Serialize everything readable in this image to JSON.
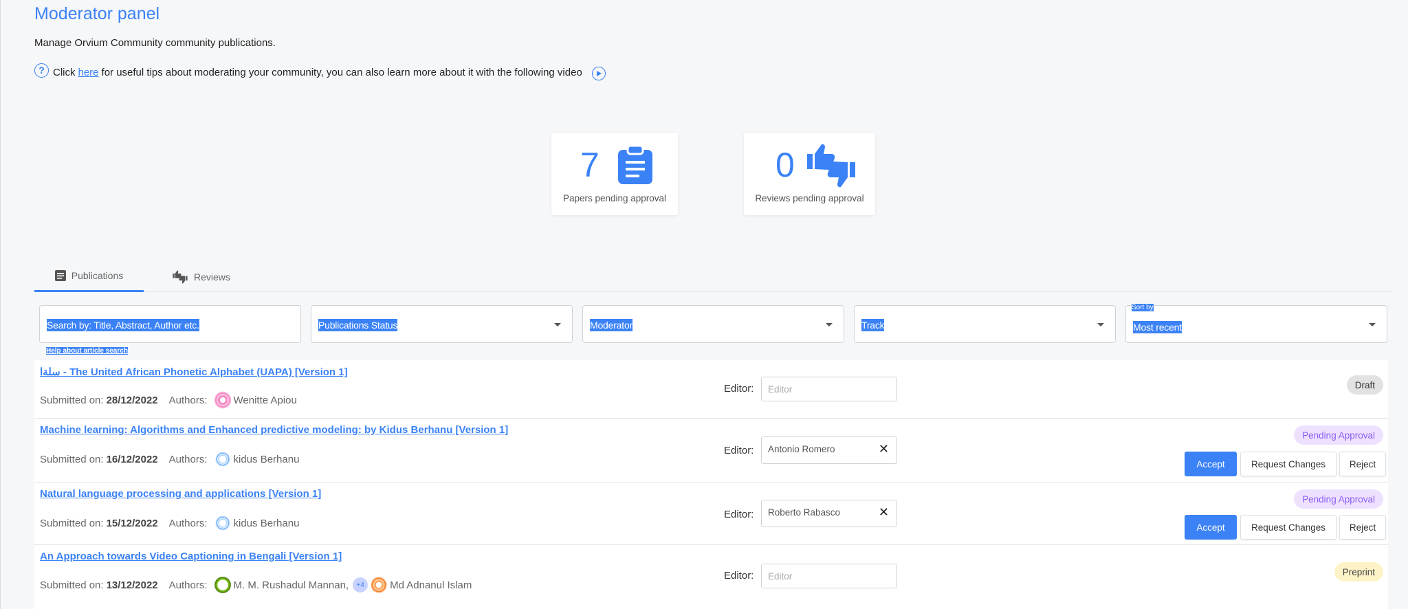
{
  "header": {
    "title": "Moderator panel",
    "subtitle": "Manage Orvium Community community publications.",
    "tips_prefix": "Click",
    "tips_link": "here",
    "tips_suffix": "for useful tips about moderating your community, you can also learn more about it with the following video"
  },
  "stats": [
    {
      "value": "7",
      "label": "Papers pending approval",
      "icon": "clipboard-icon"
    },
    {
      "value": "0",
      "label": "Reviews pending approval",
      "icon": "thumbs-up-down-icon"
    }
  ],
  "tabs": [
    {
      "label": "Publications",
      "icon": "article-icon",
      "active": true
    },
    {
      "label": "Reviews",
      "icon": "thumbs-up-down-icon",
      "active": false
    }
  ],
  "filters": {
    "search_placeholder": "Search by: Title, Abstract, Author etc.",
    "status": "Publications Status",
    "moderator": "Moderator",
    "track": "Track",
    "sort_label": "Sort by",
    "sort_value": "Most recent",
    "help_link": "Help about article search"
  },
  "labels": {
    "submitted_on": "Submitted on:",
    "authors": "Authors:",
    "editor": "Editor:",
    "editor_placeholder": "Editor",
    "accept": "Accept",
    "request_changes": "Request Changes",
    "reject": "Reject"
  },
  "publications": [
    {
      "title": "سلةا - The United African Phonetic Alphabet (UAPA) [Version 1]",
      "date": "28/12/2022",
      "authors": [
        "Wenitte Apiou"
      ],
      "editor": "",
      "status": "Draft"
    },
    {
      "title": "Machine learning: Algorithms and Enhanced predictive modeling: by Kidus Berhanu [Version 1]",
      "date": "16/12/2022",
      "authors": [
        "kidus Berhanu"
      ],
      "editor": "Antonio Romero",
      "status": "Pending Approval"
    },
    {
      "title": "Natural language processing and applications [Version 1]",
      "date": "15/12/2022",
      "authors": [
        "kidus Berhanu"
      ],
      "editor": "Roberto Rabasco",
      "status": "Pending Approval"
    },
    {
      "title": "An Approach towards Video Captioning in Bengali [Version 1]",
      "date": "13/12/2022",
      "authors": [
        "M. M. Rushadul Mannan,",
        "Md Adnanul Islam"
      ],
      "extra_authors": "+4",
      "editor": "",
      "status": "Preprint"
    }
  ],
  "colors": {
    "accent": "#3b82f6",
    "pending": "#8b5cf6",
    "preprint_bg": "#fdf3c7",
    "draft_bg": "#e2e2e2"
  }
}
